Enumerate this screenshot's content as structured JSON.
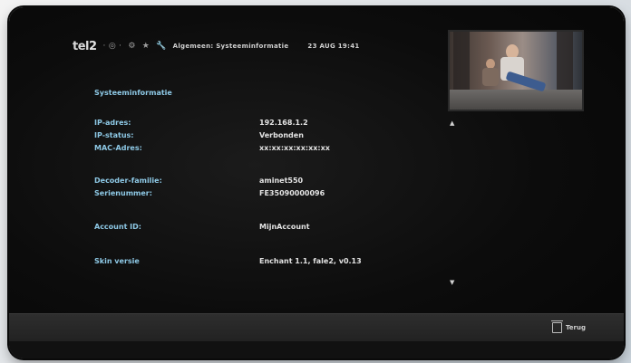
{
  "topbar": {
    "logo_prefix": "tel",
    "logo_digit": "2",
    "icon_dots": "· ◎ ·",
    "icon_settings": "⚙",
    "icon_star": "★",
    "icon_wrench": "🔧",
    "breadcrumb": "Algemeen: Systeeminformatie",
    "clock": "23 AUG 19:41"
  },
  "section": {
    "title": "Systeeminformatie"
  },
  "rows": [
    {
      "label": "IP-adres:",
      "value": "192.168.1.2"
    },
    {
      "label": "IP-status:",
      "value": "Verbonden"
    },
    {
      "label": "MAC-Adres:",
      "value": "xx:xx:xx:xx:xx:xx"
    },
    {
      "label": "Decoder-familie:",
      "value": "aminet550"
    },
    {
      "label": "Serienummer:",
      "value": "FE35090000096"
    },
    {
      "label": "Account ID:",
      "value": "MijnAccount"
    },
    {
      "label": "Skin versie",
      "value": "Enchant 1.1, fale2, v0.13"
    }
  ],
  "scroll": {
    "up": "▲",
    "down": "▼"
  },
  "bottombar": {
    "back_label": "Terug"
  },
  "colors": {
    "label": "#8ec9e6",
    "value": "#e4e4e4",
    "background": "#0c0c0c"
  }
}
